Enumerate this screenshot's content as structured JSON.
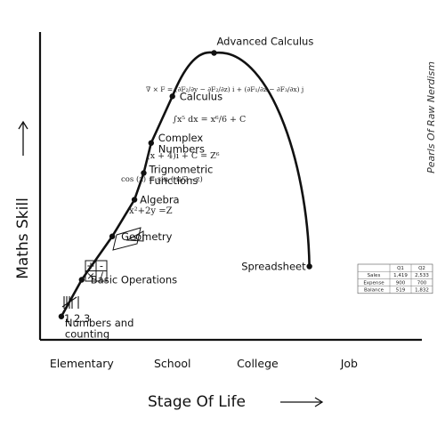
{
  "chart_data": {
    "type": "line",
    "title": "",
    "xlabel": "Stage Of Life",
    "ylabel": "Maths Skill",
    "x_categories": [
      "Elementary",
      "School",
      "College",
      "Job"
    ],
    "xlim": [
      0,
      3.3
    ],
    "ylim": [
      0,
      10
    ],
    "series": [
      {
        "points": [
          {
            "x": 0.23,
            "y": 0.7,
            "label": "Numbers and counting"
          },
          {
            "x": 0.45,
            "y": 1.8,
            "label": "Basic Operations"
          },
          {
            "x": 0.78,
            "y": 3.1,
            "label": "Geometry"
          },
          {
            "x": 1.02,
            "y": 4.2,
            "label": "Algebra"
          },
          {
            "x": 1.12,
            "y": 5.0,
            "label": "Trignometric Functions"
          },
          {
            "x": 1.2,
            "y": 5.9,
            "label": "Complex Numbers"
          },
          {
            "x": 1.43,
            "y": 7.3,
            "label": "Calculus"
          },
          {
            "x": 1.88,
            "y": 8.6,
            "label": "Advanced Calculus"
          },
          {
            "x": 2.91,
            "y": 2.2,
            "label": "Spreadsheet"
          }
        ]
      }
    ],
    "annotations": {
      "tally_numbers": "1 2 3",
      "ops_grid": [
        "+",
        "-",
        "×",
        "/"
      ],
      "algebra_formula": "x²+2y =Z",
      "trig_formula": "cos (z) = sin ( π/2 - z)",
      "complex_formula": "(x + 4)i + C = Z⁶",
      "integral_formula": "∫x⁵ dx = x⁶/6 + C",
      "curl_formula": "∇ × F = (∂F₂/∂y − ∂F₂/∂z) i + (∂F₁/∂z − ∂F₃/∂x) j",
      "spreadsheet": {
        "headers": [
          "",
          "Q1",
          "Q2"
        ],
        "rows": [
          [
            "Sales",
            "1,419",
            "2,533"
          ],
          [
            "Expense",
            "900",
            "700"
          ],
          [
            "Balance",
            "519",
            "1,832"
          ]
        ]
      }
    },
    "credit": "Pearls Of Raw Nerdism"
  }
}
